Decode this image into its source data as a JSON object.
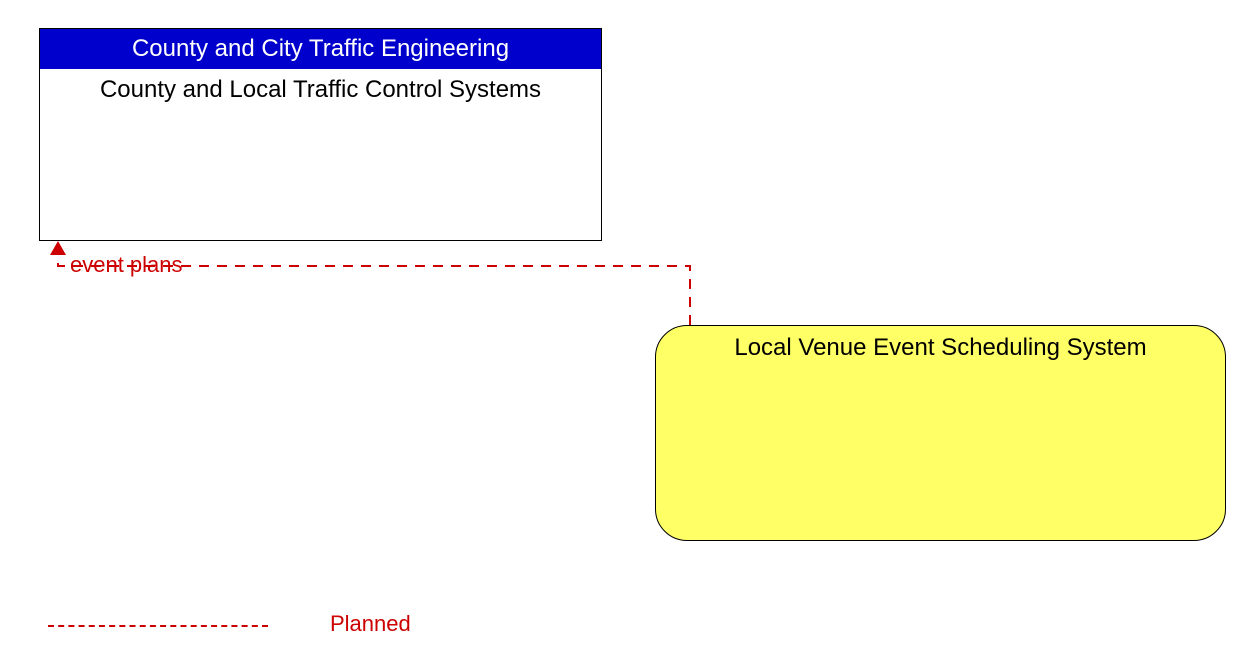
{
  "nodes": {
    "traffic_box": {
      "header": "County and City Traffic Engineering",
      "body": "County and Local Traffic Control Systems"
    },
    "venue_box": {
      "label": "Local Venue Event Scheduling System"
    }
  },
  "flow": {
    "label": "event plans"
  },
  "legend": {
    "planned": "Planned"
  }
}
